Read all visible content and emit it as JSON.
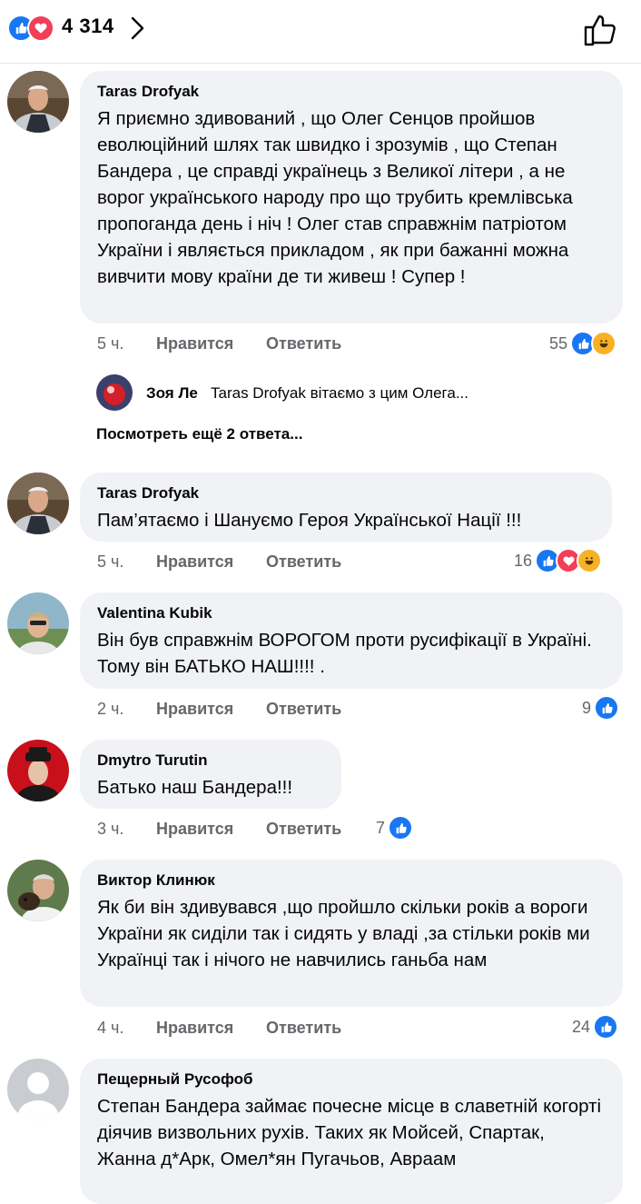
{
  "top_bar": {
    "reaction_count": "4 314",
    "reactions": [
      "like",
      "love"
    ]
  },
  "comments": [
    {
      "author": "Taras Drofyak",
      "text": "Я приємно здивований , що Олег Сенцов пройшов еволюційний шлях так швидко і зрозумів , що Степан Бандера , це справді українець з Великої літери , а не ворог українського народу про що трубить кремлівська пропоганда день і ніч ! Олег став справжнім патріотом України і являється прикладом , як при бажанні можна вивчити мову країни де ти живеш ! Супер !",
      "time": "5 ч.",
      "like_label": "Нравится",
      "reply_label": "Ответить",
      "reaction_count": "55",
      "reactions": [
        "like",
        "haha"
      ]
    },
    {
      "author": "Taras Drofyak",
      "text": "Пам’ятаємо і Шануємо Героя Української Нації !!!",
      "time": "5 ч.",
      "like_label": "Нравится",
      "reply_label": "Ответить",
      "reaction_count": "16",
      "reactions": [
        "like",
        "love",
        "haha"
      ]
    },
    {
      "author": "Valentina Kubik",
      "text": "Він був справжнім ВОРОГОМ проти русифікації в Україні. Тому він БАТЬКО НАШ!!!! .",
      "time": "2 ч.",
      "like_label": "Нравится",
      "reply_label": "Ответить",
      "reaction_count": "9",
      "reactions": [
        "like"
      ]
    },
    {
      "author": "Dmytro Turutin",
      "text": "Батько наш Бандера!!!",
      "time": "3 ч.",
      "like_label": "Нравится",
      "reply_label": "Ответить",
      "reaction_count": "7",
      "reactions": [
        "like"
      ]
    },
    {
      "author": "Виктор Клинюк",
      "text": "Як би він здивувався ,що пройшло скільки років а вороги України як сиділи так і сидять у владі ,за стільки років ми Українці так і нічого не навчились ганьба нам",
      "time": "4 ч.",
      "like_label": "Нравится",
      "reply_label": "Ответить",
      "reaction_count": "24",
      "reactions": [
        "like"
      ]
    },
    {
      "author": "Пещерный Русофоб",
      "text": "Степан Бандера займає почесне місце в славетній когорті діячив визвольних рухів. Таких як Мойсей, Спартак, Жанна д*Арк, Омел*ян Пугачьов, Авраам",
      "time": "",
      "like_label": "",
      "reply_label": "",
      "reaction_count": "",
      "reactions": []
    }
  ],
  "reply_preview": {
    "name": "Зоя Ле",
    "snippet": "Taras Drofyak вітаємо з цим Олега..."
  },
  "more_replies_label": "Посмотреть ещё 2 ответа...",
  "colors": {
    "like": "#1877f2",
    "love": "#f33e58",
    "haha": "#f7b125",
    "bubble": "#f0f2f5",
    "secondary_text": "#65676b"
  }
}
